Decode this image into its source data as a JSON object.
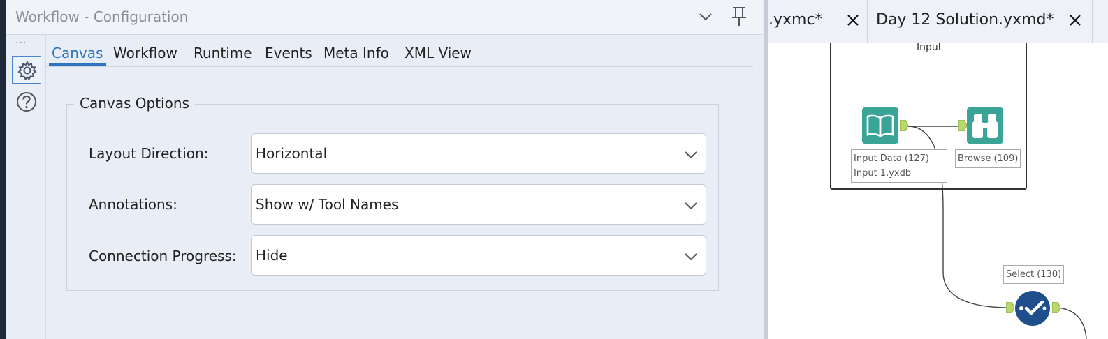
{
  "panel": {
    "title": "Workflow - Configuration",
    "dots": "···"
  },
  "tabs": [
    {
      "label": "Canvas",
      "active": true
    },
    {
      "label": "Workflow",
      "active": false
    },
    {
      "label": "Runtime",
      "active": false
    },
    {
      "label": "Events",
      "active": false
    },
    {
      "label": "Meta Info",
      "active": false
    },
    {
      "label": "XML View",
      "active": false
    }
  ],
  "canvas_options": {
    "legend": "Canvas Options",
    "rows": [
      {
        "label": "Layout Direction:",
        "value": "Horizontal"
      },
      {
        "label": "Annotations:",
        "value": "Show w/ Tool Names"
      },
      {
        "label": "Connection Progress:",
        "value": "Hide"
      }
    ]
  },
  "doc_tabs": [
    {
      "label": ".yxmc*"
    },
    {
      "label": "Day 12 Solution.yxmd*"
    }
  ],
  "workflow": {
    "container_title": "Input",
    "tools": [
      {
        "name": "Input Data (127)",
        "sub": "Input 1.yxdb"
      },
      {
        "name": "Browse (109)"
      },
      {
        "name": "Select (130)"
      }
    ]
  },
  "colors": {
    "accent": "#2e73c0",
    "input_tool": "#3aa597",
    "browse_tool": "#3aa597",
    "select_tool": "#1f4e8c",
    "anchor": "#b9d96a"
  },
  "icons": {
    "collapse": "chevron-down-icon",
    "pin": "pin-icon",
    "settings": "gear-icon",
    "help": "help-icon",
    "close": "close-icon",
    "input_tool": "book-icon",
    "browse_tool": "binoculars-icon",
    "select_tool": "checkmark-icon"
  }
}
